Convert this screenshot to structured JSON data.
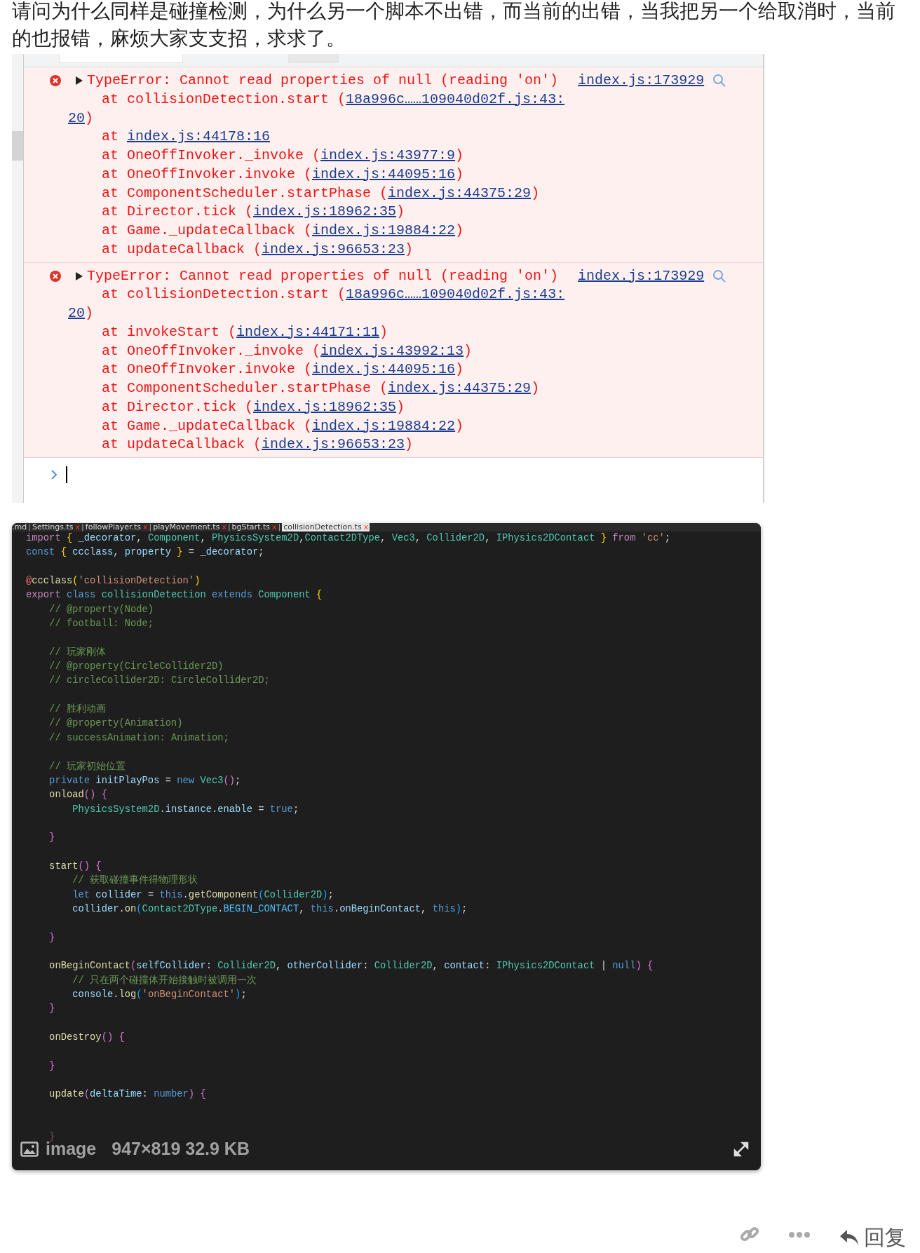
{
  "question": "请问为什么同样是碰撞检测，为什么另一个脚本不出错，而当前的出错，当我把另一个给取消时，当前的也报错，麻烦大家支支招，求求了。",
  "console": {
    "entries": [
      {
        "kind": "error",
        "message": "TypeError: Cannot read properties of null (reading 'on')",
        "source": "index.js:173929",
        "stack": [
          {
            "prefix": "at collisionDetection.start (",
            "link_lines": [
              "18a996c……109040d02f.js:43:",
              "20"
            ],
            "suffix": ")"
          },
          {
            "prefix": "at ",
            "link_lines": [
              "index.js:44178:16"
            ]
          },
          {
            "prefix": "at OneOffInvoker._invoke (",
            "link_lines": [
              "index.js:43977:9"
            ],
            "suffix": ")"
          },
          {
            "prefix": "at OneOffInvoker.invoke (",
            "link_lines": [
              "index.js:44095:16"
            ],
            "suffix": ")"
          },
          {
            "prefix": "at ComponentScheduler.startPhase (",
            "link_lines": [
              "index.js:44375:29"
            ],
            "suffix": ")"
          },
          {
            "prefix": "at Director.tick (",
            "link_lines": [
              "index.js:18962:35"
            ],
            "suffix": ")"
          },
          {
            "prefix": "at Game._updateCallback (",
            "link_lines": [
              "index.js:19884:22"
            ],
            "suffix": ")"
          },
          {
            "prefix": "at updateCallback (",
            "link_lines": [
              "index.js:96653:23"
            ],
            "suffix": ")"
          }
        ]
      },
      {
        "kind": "error",
        "message": "TypeError: Cannot read properties of null (reading 'on')",
        "source": "index.js:173929",
        "stack": [
          {
            "prefix": "at collisionDetection.start (",
            "link_lines": [
              "18a996c……109040d02f.js:43:",
              "20"
            ],
            "suffix": ")"
          },
          {
            "prefix": "at invokeStart (",
            "link_lines": [
              "index.js:44171:11"
            ],
            "suffix": ")"
          },
          {
            "prefix": "at OneOffInvoker._invoke (",
            "link_lines": [
              "index.js:43992:13"
            ],
            "suffix": ")"
          },
          {
            "prefix": "at OneOffInvoker.invoke (",
            "link_lines": [
              "index.js:44095:16"
            ],
            "suffix": ")"
          },
          {
            "prefix": "at ComponentScheduler.startPhase (",
            "link_lines": [
              "index.js:44375:29"
            ],
            "suffix": ")"
          },
          {
            "prefix": "at Director.tick (",
            "link_lines": [
              "index.js:18962:35"
            ],
            "suffix": ")"
          },
          {
            "prefix": "at Game._updateCallback (",
            "link_lines": [
              "index.js:19884:22"
            ],
            "suffix": ")"
          },
          {
            "prefix": "at updateCallback (",
            "link_lines": [
              "index.js:96653:23"
            ],
            "suffix": ")"
          }
        ]
      }
    ]
  },
  "code_image": {
    "tabs": [
      {
        "label": ".md",
        "selected": false
      },
      {
        "separator": "|",
        "label": "Settings.ts",
        "selected": false,
        "close": "x"
      },
      {
        "separator": "|",
        "label": "followPlayer.ts",
        "selected": false,
        "close": "x"
      },
      {
        "separator": "|",
        "label": "playMovement.ts",
        "selected": false,
        "close": "x"
      },
      {
        "separator": "|",
        "label": "bgStart.ts",
        "selected": false,
        "close": "x"
      },
      {
        "separator": "|",
        "label": "collisionDetection.ts",
        "selected": true,
        "close": "x"
      }
    ],
    "lines": [
      {
        "kind": "code",
        "tokens": [
          {
            "kind": "ctl",
            "text": "import "
          },
          {
            "kind": "br1",
            "text": "{"
          },
          {
            "kind": "var",
            "text": " _decorator"
          },
          {
            "kind": "plain",
            "text": ", "
          },
          {
            "kind": "type",
            "text": "Component"
          },
          {
            "kind": "plain",
            "text": ", "
          },
          {
            "kind": "type",
            "text": "PhysicsSystem2D"
          },
          {
            "kind": "plain",
            "text": ","
          },
          {
            "kind": "type",
            "text": "Contact2DType"
          },
          {
            "kind": "plain",
            "text": ", "
          },
          {
            "kind": "type",
            "text": "Vec3"
          },
          {
            "kind": "plain",
            "text": ", "
          },
          {
            "kind": "type",
            "text": "Collider2D"
          },
          {
            "kind": "plain",
            "text": ", "
          },
          {
            "kind": "type",
            "text": "IPhysics2DContact "
          },
          {
            "kind": "br1",
            "text": "}"
          },
          {
            "kind": "ctl",
            "text": " from "
          },
          {
            "kind": "str",
            "text": "'cc'"
          },
          {
            "kind": "plain",
            "text": ";"
          }
        ]
      },
      {
        "kind": "code",
        "tokens": [
          {
            "kind": "kw",
            "text": "const "
          },
          {
            "kind": "br1",
            "text": "{"
          },
          {
            "kind": "var",
            "text": " ccclass, property "
          },
          {
            "kind": "br1",
            "text": "}"
          },
          {
            "kind": "plain",
            "text": " = "
          },
          {
            "kind": "var",
            "text": "_decorator"
          },
          {
            "kind": "plain",
            "text": ";"
          }
        ]
      },
      {
        "kind": "blank"
      },
      {
        "kind": "code",
        "tokens": [
          {
            "kind": "dec",
            "text": "@"
          },
          {
            "kind": "fn",
            "text": "ccclass"
          },
          {
            "kind": "br1",
            "text": "("
          },
          {
            "kind": "str",
            "text": "'collisionDetection'"
          },
          {
            "kind": "br1",
            "text": ")"
          }
        ]
      },
      {
        "kind": "code",
        "tokens": [
          {
            "kind": "ctl",
            "text": "export "
          },
          {
            "kind": "kw",
            "text": "class "
          },
          {
            "kind": "type",
            "text": "collisionDetection "
          },
          {
            "kind": "kw",
            "text": "extends "
          },
          {
            "kind": "type",
            "text": "Component "
          },
          {
            "kind": "br1",
            "text": "{"
          }
        ]
      },
      {
        "kind": "code",
        "tokens": [
          {
            "kind": "cmt",
            "text": "    // @property(Node)"
          }
        ]
      },
      {
        "kind": "code",
        "tokens": [
          {
            "kind": "cmt",
            "text": "    // football: Node;"
          }
        ]
      },
      {
        "kind": "blank"
      },
      {
        "kind": "code",
        "tokens": [
          {
            "kind": "cmt",
            "text": "    // 玩家刚体"
          }
        ]
      },
      {
        "kind": "code",
        "tokens": [
          {
            "kind": "cmt",
            "text": "    // @property(CircleCollider2D)"
          }
        ]
      },
      {
        "kind": "code",
        "tokens": [
          {
            "kind": "cmt",
            "text": "    // circleCollider2D: CircleCollider2D;"
          }
        ]
      },
      {
        "kind": "blank"
      },
      {
        "kind": "code",
        "tokens": [
          {
            "kind": "cmt",
            "text": "    // 胜利动画"
          }
        ]
      },
      {
        "kind": "code",
        "tokens": [
          {
            "kind": "cmt",
            "text": "    // @property(Animation)"
          }
        ]
      },
      {
        "kind": "code",
        "tokens": [
          {
            "kind": "cmt",
            "text": "    // successAnimation: Animation;"
          }
        ]
      },
      {
        "kind": "blank"
      },
      {
        "kind": "code",
        "tokens": [
          {
            "kind": "cmt",
            "text": "    // 玩家初始位置"
          }
        ]
      },
      {
        "kind": "code",
        "tokens": [
          {
            "kind": "kw",
            "text": "    private "
          },
          {
            "kind": "var",
            "text": "initPlayPos"
          },
          {
            "kind": "plain",
            "text": " = "
          },
          {
            "kind": "kw",
            "text": "new "
          },
          {
            "kind": "type",
            "text": "Vec3"
          },
          {
            "kind": "br2",
            "text": "()"
          },
          {
            "kind": "plain",
            "text": ";"
          }
        ]
      },
      {
        "kind": "code",
        "tokens": [
          {
            "kind": "fn",
            "text": "    onload"
          },
          {
            "kind": "br2",
            "text": "()"
          },
          {
            "kind": "br2",
            "text": " {"
          }
        ]
      },
      {
        "kind": "code",
        "tokens": [
          {
            "kind": "type",
            "text": "        PhysicsSystem2D"
          },
          {
            "kind": "plain",
            "text": "."
          },
          {
            "kind": "var",
            "text": "instance"
          },
          {
            "kind": "plain",
            "text": "."
          },
          {
            "kind": "var",
            "text": "enable"
          },
          {
            "kind": "plain",
            "text": " = "
          },
          {
            "kind": "kw",
            "text": "true"
          },
          {
            "kind": "plain",
            "text": ";"
          }
        ]
      },
      {
        "kind": "blank"
      },
      {
        "kind": "code",
        "tokens": [
          {
            "kind": "br2",
            "text": "    }"
          }
        ]
      },
      {
        "kind": "blank"
      },
      {
        "kind": "code",
        "tokens": [
          {
            "kind": "fn",
            "text": "    start"
          },
          {
            "kind": "br2",
            "text": "()"
          },
          {
            "kind": "br2",
            "text": " {"
          }
        ]
      },
      {
        "kind": "code",
        "tokens": [
          {
            "kind": "cmt",
            "text": "        // 获取碰撞事件得物理形状"
          }
        ]
      },
      {
        "kind": "code",
        "tokens": [
          {
            "kind": "kw",
            "text": "        let "
          },
          {
            "kind": "var",
            "text": "collider"
          },
          {
            "kind": "plain",
            "text": " = "
          },
          {
            "kind": "kw",
            "text": "this"
          },
          {
            "kind": "plain",
            "text": "."
          },
          {
            "kind": "fn",
            "text": "getComponent"
          },
          {
            "kind": "br3",
            "text": "("
          },
          {
            "kind": "type",
            "text": "Collider2D"
          },
          {
            "kind": "br3",
            "text": ")"
          },
          {
            "kind": "plain",
            "text": ";"
          }
        ]
      },
      {
        "kind": "code",
        "tokens": [
          {
            "kind": "var",
            "text": "        collider"
          },
          {
            "kind": "plain",
            "text": "."
          },
          {
            "kind": "fn",
            "text": "on"
          },
          {
            "kind": "br3",
            "text": "("
          },
          {
            "kind": "type",
            "text": "Contact2DType"
          },
          {
            "kind": "plain",
            "text": "."
          },
          {
            "kind": "const",
            "text": "BEGIN_CONTACT"
          },
          {
            "kind": "plain",
            "text": ", "
          },
          {
            "kind": "kw",
            "text": "this"
          },
          {
            "kind": "plain",
            "text": "."
          },
          {
            "kind": "var",
            "text": "onBeginContact"
          },
          {
            "kind": "plain",
            "text": ", "
          },
          {
            "kind": "kw",
            "text": "this"
          },
          {
            "kind": "br3",
            "text": ")"
          },
          {
            "kind": "plain",
            "text": ";"
          }
        ]
      },
      {
        "kind": "blank"
      },
      {
        "kind": "code",
        "tokens": [
          {
            "kind": "br2",
            "text": "    }"
          }
        ]
      },
      {
        "kind": "blank"
      },
      {
        "kind": "code",
        "tokens": [
          {
            "kind": "fn",
            "text": "    onBeginContact"
          },
          {
            "kind": "br2",
            "text": "("
          },
          {
            "kind": "var",
            "text": "selfCollider"
          },
          {
            "kind": "plain",
            "text": ": "
          },
          {
            "kind": "type",
            "text": "Collider2D"
          },
          {
            "kind": "plain",
            "text": ", "
          },
          {
            "kind": "var",
            "text": "otherCollider"
          },
          {
            "kind": "plain",
            "text": ": "
          },
          {
            "kind": "type",
            "text": "Collider2D"
          },
          {
            "kind": "plain",
            "text": ", "
          },
          {
            "kind": "var",
            "text": "contact"
          },
          {
            "kind": "plain",
            "text": ": "
          },
          {
            "kind": "type",
            "text": "IPhysics2DContact"
          },
          {
            "kind": "plain",
            "text": " | "
          },
          {
            "kind": "kw",
            "text": "null"
          },
          {
            "kind": "br2",
            "text": ")"
          },
          {
            "kind": "br2",
            "text": " {"
          }
        ]
      },
      {
        "kind": "code",
        "tokens": [
          {
            "kind": "cmt",
            "text": "        // 只在两个碰撞体开始接触时被调用一次"
          }
        ]
      },
      {
        "kind": "code",
        "tokens": [
          {
            "kind": "var",
            "text": "        console"
          },
          {
            "kind": "plain",
            "text": "."
          },
          {
            "kind": "fn",
            "text": "log"
          },
          {
            "kind": "br3",
            "text": "("
          },
          {
            "kind": "str",
            "text": "'onBeginContact'"
          },
          {
            "kind": "br3",
            "text": ")"
          },
          {
            "kind": "plain",
            "text": ";"
          }
        ]
      },
      {
        "kind": "code",
        "tokens": [
          {
            "kind": "br2",
            "text": "    }"
          }
        ]
      },
      {
        "kind": "blank"
      },
      {
        "kind": "code",
        "tokens": [
          {
            "kind": "fn",
            "text": "    onDestroy"
          },
          {
            "kind": "br2",
            "text": "()"
          },
          {
            "kind": "br2",
            "text": " {"
          }
        ]
      },
      {
        "kind": "blank"
      },
      {
        "kind": "code",
        "tokens": [
          {
            "kind": "br2",
            "text": "    }"
          }
        ]
      },
      {
        "kind": "blank"
      },
      {
        "kind": "code",
        "tokens": [
          {
            "kind": "fn",
            "text": "    update"
          },
          {
            "kind": "br2",
            "text": "("
          },
          {
            "kind": "var",
            "text": "deltaTime"
          },
          {
            "kind": "plain",
            "text": ": "
          },
          {
            "kind": "kw",
            "text": "number"
          },
          {
            "kind": "br2",
            "text": ")"
          },
          {
            "kind": "br2",
            "text": " {"
          }
        ]
      },
      {
        "kind": "blank"
      },
      {
        "kind": "blank"
      },
      {
        "kind": "code",
        "tokens": [
          {
            "kind": "br2",
            "text": "    }"
          }
        ]
      }
    ],
    "caption": "image",
    "meta": "947×819 32.9 KB"
  },
  "actions": {
    "reply": "回复"
  }
}
